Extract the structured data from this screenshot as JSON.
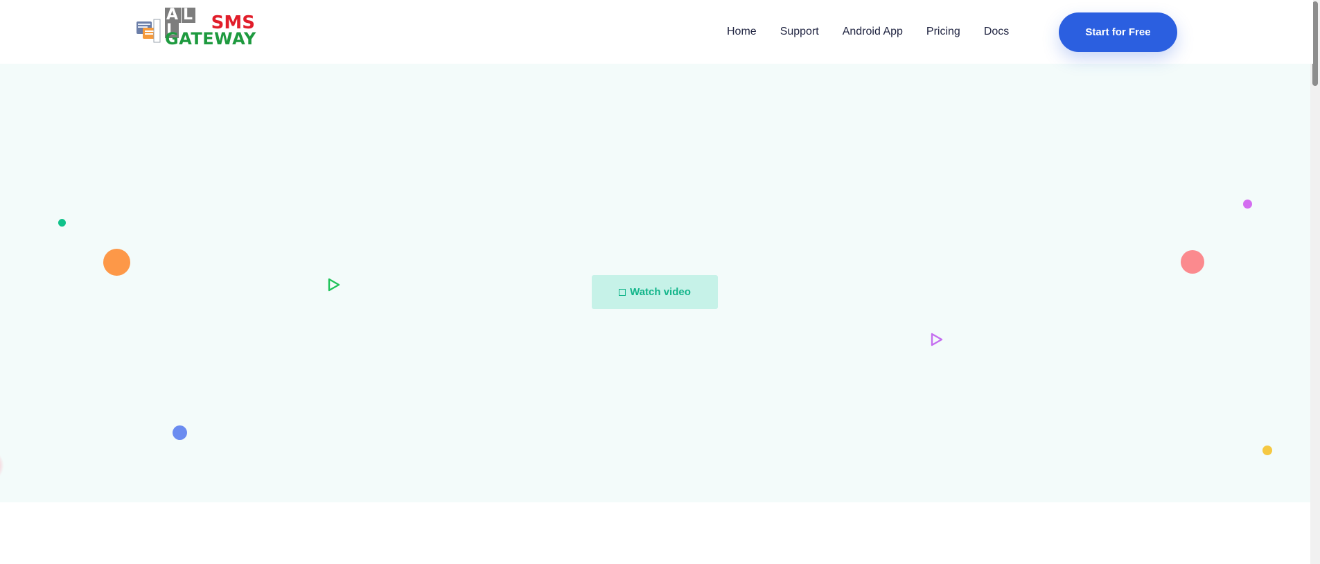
{
  "header": {
    "logo": {
      "alt": "ALL SMS GATEWAY",
      "letters_all": [
        "A",
        "L",
        "L"
      ],
      "sms": "SMS",
      "gateway": "GATEWAY",
      "icon": "chat-bubbles-icon"
    },
    "nav": [
      {
        "label": "Home",
        "name": "nav-home"
      },
      {
        "label": "Support",
        "name": "nav-support"
      },
      {
        "label": "Android App",
        "name": "nav-android-app"
      },
      {
        "label": "Pricing",
        "name": "nav-pricing"
      },
      {
        "label": "Docs",
        "name": "nav-docs"
      }
    ],
    "cta_label": "Start for Free"
  },
  "hero": {
    "watch_video_label": "Watch video",
    "watch_video_icon": "square-icon"
  },
  "colors": {
    "primary": "#2b5fe0",
    "hero_bg": "#f3fbfa",
    "watch_bg": "#c6f2e8",
    "watch_text": "#12b58a",
    "logo_red": "#e11d2a",
    "logo_green": "#1e9a3f",
    "logo_gray": "#7d7d7d"
  }
}
